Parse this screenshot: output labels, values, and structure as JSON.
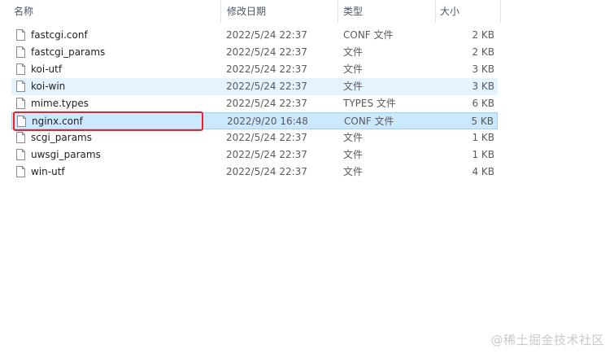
{
  "columns": {
    "name": "名称",
    "date": "修改日期",
    "type": "类型",
    "size": "大小"
  },
  "files": [
    {
      "name": "fastcgi.conf",
      "date": "2022/5/24 22:37",
      "type": "CONF 文件",
      "size": "2 KB"
    },
    {
      "name": "fastcgi_params",
      "date": "2022/5/24 22:37",
      "type": "文件",
      "size": "2 KB"
    },
    {
      "name": "koi-utf",
      "date": "2022/5/24 22:37",
      "type": "文件",
      "size": "3 KB"
    },
    {
      "name": "koi-win",
      "date": "2022/5/24 22:37",
      "type": "文件",
      "size": "3 KB"
    },
    {
      "name": "mime.types",
      "date": "2022/5/24 22:37",
      "type": "TYPES 文件",
      "size": "6 KB"
    },
    {
      "name": "nginx.conf",
      "date": "2022/9/20 16:48",
      "type": "CONF 文件",
      "size": "5 KB"
    },
    {
      "name": "scgi_params",
      "date": "2022/5/24 22:37",
      "type": "文件",
      "size": "1 KB"
    },
    {
      "name": "uwsgi_params",
      "date": "2022/5/24 22:37",
      "type": "文件",
      "size": "1 KB"
    },
    {
      "name": "win-utf",
      "date": "2022/5/24 22:37",
      "type": "文件",
      "size": "4 KB"
    }
  ],
  "sort_indicator": "^",
  "watermark": "@稀土掘金技术社区",
  "colors": {
    "hover_row": "#e5f3ff",
    "selected_row": "#cce8ff",
    "highlight_border": "#e0262b"
  }
}
